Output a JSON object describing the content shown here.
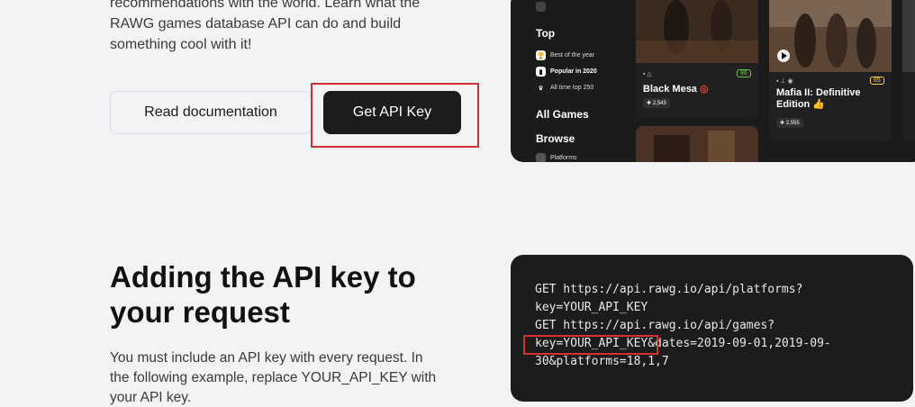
{
  "intro": {
    "text_line1": "recommendations with the world. Learn what the",
    "text_line2": "RAWG games database API can do and build",
    "text_line3": "something cool with it!"
  },
  "buttons": {
    "read_docs": "Read documentation",
    "get_key": "Get API Key"
  },
  "preview": {
    "sidebar": {
      "top_heading": "Top",
      "items": [
        "Best of the year",
        "Popular in 2020",
        "All time top 250"
      ],
      "all_games": "All Games",
      "browse": "Browse",
      "platforms": "Platforms"
    },
    "cards": [
      {
        "title": "Black Mesa",
        "score": "86",
        "added": "2,543"
      },
      {
        "title_line1": "Mafia II: Definitive",
        "title_line2": "Edition",
        "score": "65",
        "added": "2,555"
      }
    ]
  },
  "section": {
    "heading_line1": "Adding the API key to",
    "heading_line2": "your request",
    "desc_line1": "You must include an API key with every request. In",
    "desc_line2": "the following example, replace YOUR_API_KEY with",
    "desc_line3": "your API key."
  },
  "code": {
    "lines": [
      "GET https://api.rawg.io/api/platforms?",
      "key=YOUR_API_KEY",
      "GET https://api.rawg.io/api/games?",
      "key=YOUR_API_KEY&dates=2019-09-01,2019-09-",
      "30&platforms=18,1,7"
    ]
  },
  "colors": {
    "highlight": "#d63030",
    "dark_bg": "#1c1c1c",
    "page_bg": "#f2f3f5"
  }
}
